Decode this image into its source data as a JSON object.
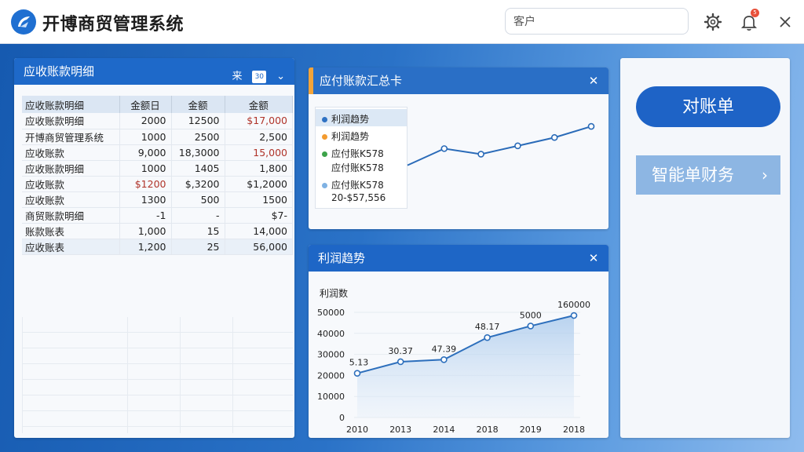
{
  "app": {
    "title": "开博商贸管理系统"
  },
  "search": {
    "value": "客户"
  },
  "toolbar": {
    "settings_icon": "gear-icon",
    "bell_icon": "bell-icon",
    "bell_badge": "5",
    "close_icon": "close-icon"
  },
  "ledger": {
    "title": "应收账款明细",
    "tool_label": "来",
    "tool_box": "30",
    "columns": [
      "应收账款明细",
      "金额日",
      "金额",
      "金额"
    ],
    "rows": [
      [
        "应收账款明细",
        "2000",
        "12500",
        "$17,000"
      ],
      [
        "开博商贸管理系统",
        "1000",
        "2500",
        "2,500"
      ],
      [
        "应收账款",
        "9,000",
        "18,3000",
        "15,000"
      ],
      [
        "应收账款明细",
        "1000",
        "1405",
        "1,800"
      ],
      [
        "应收账款",
        "$1200",
        "$,3200",
        "$1,2000"
      ],
      [
        "应收账款",
        "1300",
        "500",
        "1500"
      ],
      [
        "商贸账款明细",
        "-1",
        "-",
        "$7-"
      ],
      [
        "账款账表",
        "1,000",
        "15",
        "14,000"
      ],
      [
        "应收账表",
        "1,200",
        "25",
        "56,000"
      ]
    ]
  },
  "payable": {
    "title": "应付账款汇总卡",
    "legend": [
      {
        "label": "利润趋势",
        "color": "#2f72c3"
      },
      {
        "label": "利润趋势",
        "color": "#f39b2f"
      },
      {
        "label": "应付账K578",
        "color": "#3da34a"
      },
      {
        "label": "应付账K578",
        "color": null
      },
      {
        "label": "应付账K578",
        "color": "#7fb2e3"
      },
      {
        "label": "20-$57,556",
        "color": null
      }
    ],
    "series": [
      1,
      1.6,
      1.4,
      1.7,
      2.0,
      2.4
    ]
  },
  "profit": {
    "title": "利润趋势",
    "chart_data": {
      "type": "area",
      "title": "",
      "ylabel": "利润数",
      "yticks": [
        "0",
        "10000",
        "20000",
        "30000",
        "40000",
        "50000"
      ],
      "ylim": [
        0,
        50000
      ],
      "categories": [
        "2010",
        "2013",
        "2014",
        "2018",
        "2019",
        "2018"
      ],
      "values": [
        21000,
        26500,
        27500,
        38000,
        43500,
        48500
      ],
      "labels": [
        "5.13",
        "30.37",
        "47.39",
        "48.17",
        "5000",
        "160000"
      ]
    }
  },
  "right": {
    "btn_recon": "对账单",
    "btn_smart": "智能单财务",
    "btn_smart_arrow": "›"
  }
}
